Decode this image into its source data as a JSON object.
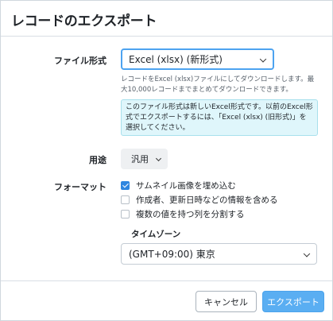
{
  "dialog": {
    "title": "レコードのエクスポート"
  },
  "file_format": {
    "label": "ファイル形式",
    "selected": "Excel (xlsx) (新形式)",
    "help_text": "レコードをExcel (xlsx)ファイルにしてダウンロードします。最大10,000レコードまでまとめてダウンロードできます。",
    "info_text": "このファイル形式は新しいExcel形式です。以前のExcel形式でエクスポートするには、「Excel (xlsx) (旧形式)」を選択してください。"
  },
  "purpose": {
    "label": "用途",
    "selected": "汎用"
  },
  "formatting": {
    "label": "フォーマット",
    "options": [
      {
        "label": "サムネイル画像を埋め込む",
        "checked": true
      },
      {
        "label": "作成者、更新日時などの情報を含める",
        "checked": false
      },
      {
        "label": "複数の値を持つ列を分割する",
        "checked": false
      }
    ]
  },
  "timezone": {
    "label": "タイムゾーン",
    "selected": "(GMT+09:00) 東京"
  },
  "footer": {
    "cancel_label": "キャンセル",
    "export_label": "エクスポート"
  },
  "colors": {
    "accent": "#5aaef2",
    "checkbox_checked": "#2f86e0",
    "info_background": "#dff6fb"
  },
  "icons": [
    "chevron-down-icon",
    "check-icon"
  ]
}
